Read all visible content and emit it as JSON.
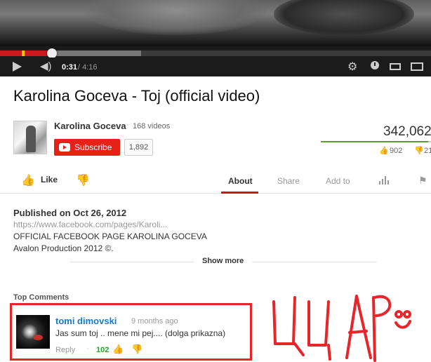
{
  "player": {
    "time_current": "0:31",
    "time_total": " / 4:16",
    "progress_fraction": 0.121,
    "loaded_fraction": 0.327,
    "icons": [
      "play-icon",
      "volume-icon",
      "gear-icon",
      "watch-later-icon",
      "theater-mode-icon",
      "fullscreen-icon"
    ]
  },
  "video": {
    "title": "Karolina Goceva - Toj (official video)"
  },
  "channel": {
    "name": "Karolina Goceva",
    "video_count": "168 videos",
    "subscribe_label": "Subscribe",
    "subscriber_count": "1,892"
  },
  "stats": {
    "views": "342,062",
    "likes": "902",
    "dislikes": "21",
    "like_ratio": 0.977,
    "like_bar_color": "#59a02a"
  },
  "actions": {
    "like_label": "Like",
    "tabs": [
      "About",
      "Share",
      "Add to"
    ],
    "active_tab": "About",
    "accent_color": "#cc181e"
  },
  "description": {
    "published": "Published on Oct 26, 2012",
    "link": "https://www.facebook.com/pages/Karoli...",
    "line1": "OFFICIAL FACEBOOK PAGE KAROLINA GOCEVA",
    "line2": "Avalon Production 2012 ©.",
    "show_more": "Show more"
  },
  "comments": {
    "heading": "Top Comments",
    "items": [
      {
        "author": "tomi dimovski",
        "time": "9 months ago",
        "text": "Jas sum toj .. mene mi pej.... (dolga prikazna)",
        "reply_label": "Reply",
        "likes": "102"
      }
    ]
  },
  "annotation": {
    "scribble_text": "ЦАР",
    "color": "#e6262b"
  }
}
